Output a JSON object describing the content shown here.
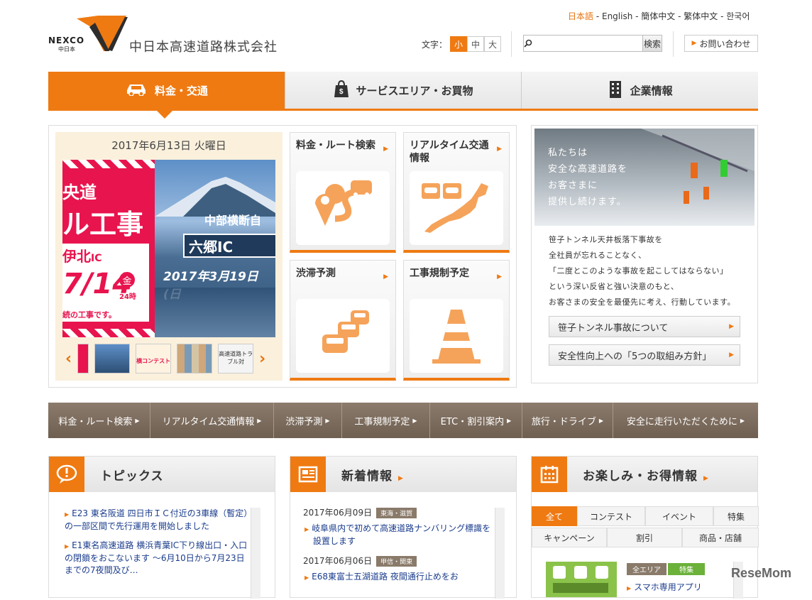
{
  "header": {
    "logo_text": "NEXCO",
    "logo_sub": "中日本",
    "company_name": "中日本高速道路株式会社",
    "languages": [
      "日本語",
      "English",
      "簡体中文",
      "繁体中文",
      "한국어"
    ],
    "font_size_label": "文字：",
    "font_sizes": [
      "小",
      "中",
      "大"
    ],
    "search_button": "検索",
    "contact_button": "お問い合わせ"
  },
  "main_nav": {
    "items": [
      "料金・交通",
      "サービスエリア・お買物",
      "企業情報"
    ]
  },
  "slider": {
    "date": "2017年6月13日 火曜日",
    "banner_left": {
      "line1": "央道",
      "line2": "ル工事",
      "line3": "伊北",
      "line3_suffix": "IC",
      "date_big": "7/14",
      "day": "金",
      "hours": "24時",
      "note": "続の工事です。"
    },
    "banner_right": {
      "line1": "中部横断自",
      "line2": "六郷IC",
      "date": "2017年3月19日(日"
    },
    "thumbs": [
      "",
      "",
      "横コンテスト",
      "",
      "高速道路トラブル対"
    ]
  },
  "tiles": [
    {
      "title": "料金・ルート検索"
    },
    {
      "title": "リアルタイム交通情報"
    },
    {
      "title": "渋滞予測"
    },
    {
      "title": "工事規制予定"
    }
  ],
  "safety": {
    "message": [
      "私たちは",
      "安全な高速道路を",
      "お客さまに",
      "提供し続けます。"
    ],
    "text": [
      "笹子トンネル天井板落下事故を",
      "全社員が忘れることなく、",
      "「二度とこのような事故を起こしてはならない」",
      "という深い反省と強い決意のもと、",
      "お客さまの安全を最優先に考え、行動しています。"
    ],
    "buttons": [
      "笹子トンネル事故について",
      "安全性向上への「5つの取組み方針」"
    ]
  },
  "sub_nav": {
    "items": [
      "料金・ルート検索",
      "リアルタイム交通情報",
      "渋滞予測",
      "工事規制予定",
      "ETC・割引案内",
      "旅行・ドライブ",
      "安全に走行いただくために"
    ]
  },
  "topics": {
    "title": "トピックス",
    "items": [
      "E23 東名阪道 四日市ＩＣ付近の3車線（暫定）の一部区間で先行運用を開始しました",
      "E1東名高速道路 横浜青葉IC下り線出口・入口の閉鎖をおこないます ～6月10日から7月23日までの7夜間及び…"
    ]
  },
  "news": {
    "title": "新着情報",
    "items": [
      {
        "date": "2017年06月09日",
        "tag": "東海・滋賀",
        "text": "岐阜県内で初めて高速道路ナンバリング標識を設置します"
      },
      {
        "date": "2017年06月06日",
        "tag": "甲信・関東",
        "text": "E68東富士五湖道路 夜間通行止めをお"
      }
    ]
  },
  "deals": {
    "title": "お楽しみ・お得情報",
    "tabs_row1": [
      "全て",
      "コンテスト",
      "イベント",
      "特集"
    ],
    "tabs_row2": [
      "キャンペーン",
      "割引",
      "商品・店舗"
    ],
    "item_tags": [
      "全エリア",
      "特集"
    ],
    "item_text": "スマホ専用アプリ"
  },
  "watermark": "ReseMom",
  "colors": {
    "accent": "#ef7a12",
    "subnav": "#7d6d5e"
  }
}
